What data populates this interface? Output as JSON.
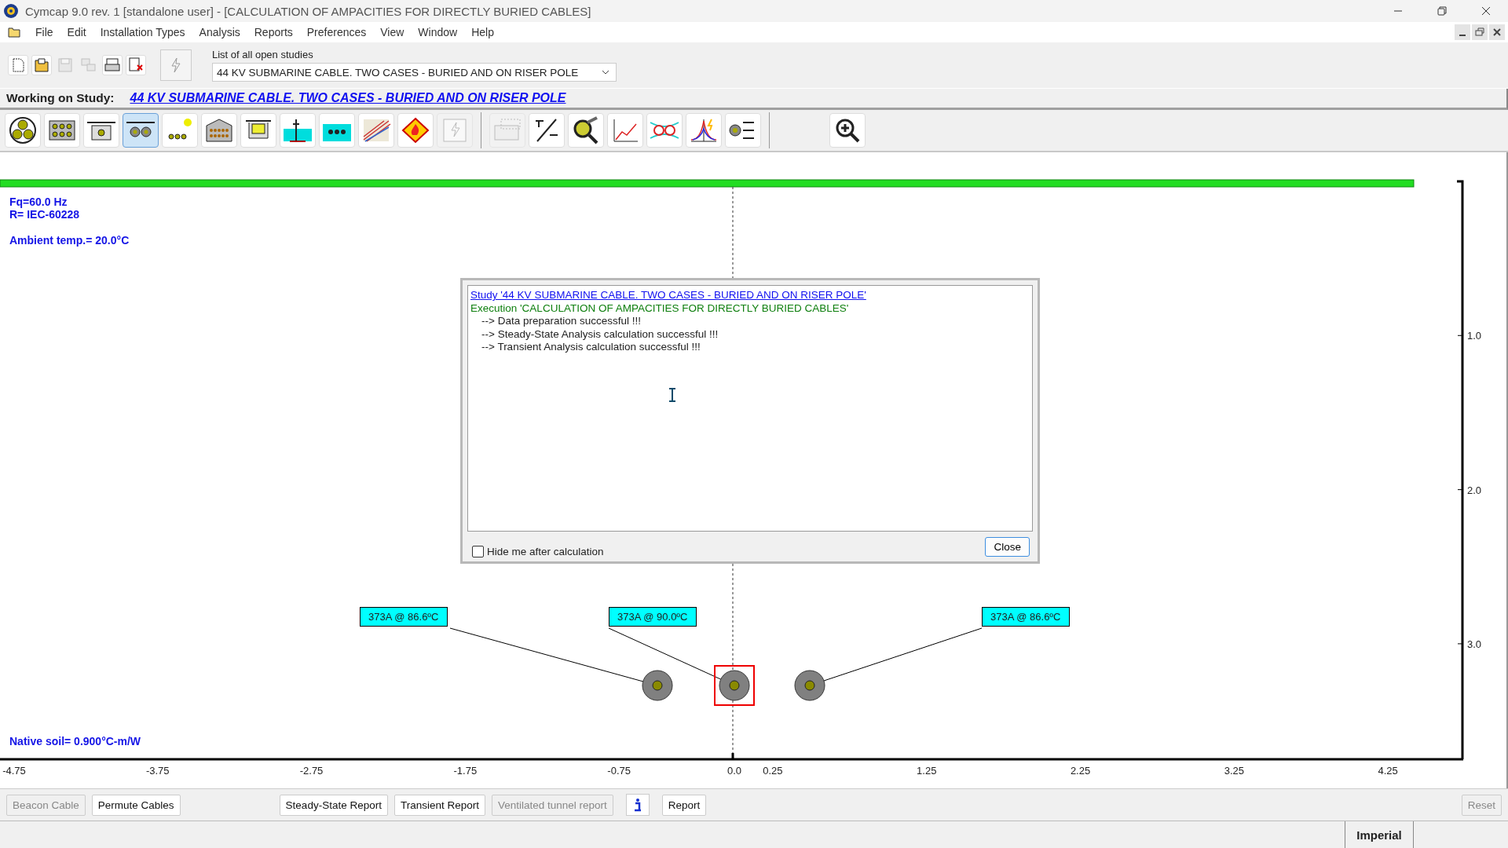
{
  "window": {
    "title": "Cymcap 9.0 rev. 1 [standalone user] - [CALCULATION OF AMPACITIES FOR DIRECTLY BURIED CABLES]"
  },
  "menu": [
    "File",
    "Edit",
    "Installation Types",
    "Analysis",
    "Reports",
    "Preferences",
    "View",
    "Window",
    "Help"
  ],
  "toolbar": {
    "studies_label": "List of all open studies",
    "studies_value": "44 KV SUBMARINE CABLE. TWO CASES - BURIED AND ON RISER POLE",
    "file_buttons": [
      {
        "disabled": false
      },
      {
        "disabled": false
      },
      {
        "disabled": true
      },
      {
        "disabled": true
      },
      {
        "disabled": false
      },
      {
        "disabled": false
      }
    ]
  },
  "study": {
    "label": "Working on Study:",
    "name": "44 KV SUBMARINE CABLE. TWO CASES - BURIED AND ON RISER POLE"
  },
  "installation_tools": [
    {
      "selected": false,
      "disabled": false
    },
    {
      "selected": false,
      "disabled": false
    },
    {
      "selected": false,
      "disabled": false
    },
    {
      "selected": true,
      "disabled": false
    },
    {
      "selected": false,
      "disabled": false
    },
    {
      "selected": false,
      "disabled": false
    },
    {
      "selected": false,
      "disabled": false
    },
    {
      "selected": false,
      "disabled": false
    },
    {
      "selected": false,
      "disabled": false
    },
    {
      "selected": false,
      "disabled": false
    },
    {
      "selected": false,
      "disabled": false
    },
    {
      "selected": false,
      "disabled": true
    }
  ],
  "analysis_tools": [
    {
      "disabled": true
    },
    {
      "disabled": false
    },
    {
      "disabled": false
    },
    {
      "disabled": false
    },
    {
      "disabled": false
    },
    {
      "disabled": false
    },
    {
      "disabled": false
    }
  ],
  "canvas": {
    "info": [
      "Fq=60.0 Hz",
      "R= IEC-60228"
    ],
    "ambient": "Ambient temp.= 20.0°C",
    "soil": "Native soil= 0.900°C-m/W",
    "x_ticks": [
      "-4.75",
      "-3.75",
      "-2.75",
      "-1.75",
      "-0.75",
      "0.0",
      "0.25",
      "1.25",
      "2.25",
      "3.25",
      "4.25"
    ],
    "y_ticks": [
      "1.0",
      "2.0",
      "3.0"
    ],
    "cables": [
      {
        "label": "373A @ 86.6ºC",
        "selected": false
      },
      {
        "label": "373A @ 90.0ºC",
        "selected": true
      },
      {
        "label": "373A @ 86.6ºC",
        "selected": false
      }
    ]
  },
  "dialog": {
    "lines": [
      {
        "kind": "link",
        "text": "Study '44 KV SUBMARINE CABLE. TWO CASES - BURIED AND ON RISER POLE'"
      },
      {
        "kind": "execution",
        "text": "Execution 'CALCULATION OF AMPACITIES FOR DIRECTLY BURIED CABLES'"
      },
      {
        "kind": "step",
        "text": "--> Data preparation successful !!!"
      },
      {
        "kind": "step",
        "text": "--> Steady-State Analysis calculation successful !!!"
      },
      {
        "kind": "step",
        "text": "--> Transient Analysis calculation successful !!!"
      }
    ],
    "checkbox": {
      "label": "Hide me after calculation",
      "checked": false
    },
    "button": "Close"
  },
  "bottom_buttons": [
    {
      "kind": "button",
      "label": "Beacon Cable",
      "disabled": true
    },
    {
      "kind": "button",
      "label": "Permute Cables",
      "disabled": false
    },
    {
      "kind": "gap"
    },
    {
      "kind": "button",
      "label": "Steady-State Report",
      "disabled": false
    },
    {
      "kind": "button",
      "label": "Transient Report",
      "disabled": false
    },
    {
      "kind": "button",
      "label": "Ventilated tunnel report",
      "disabled": true
    },
    {
      "kind": "info"
    },
    {
      "kind": "button",
      "label": "Report",
      "disabled": false
    },
    {
      "kind": "spacer"
    },
    {
      "kind": "button",
      "label": "Reset",
      "disabled": true
    }
  ],
  "status_bar": {
    "units": "Imperial"
  }
}
